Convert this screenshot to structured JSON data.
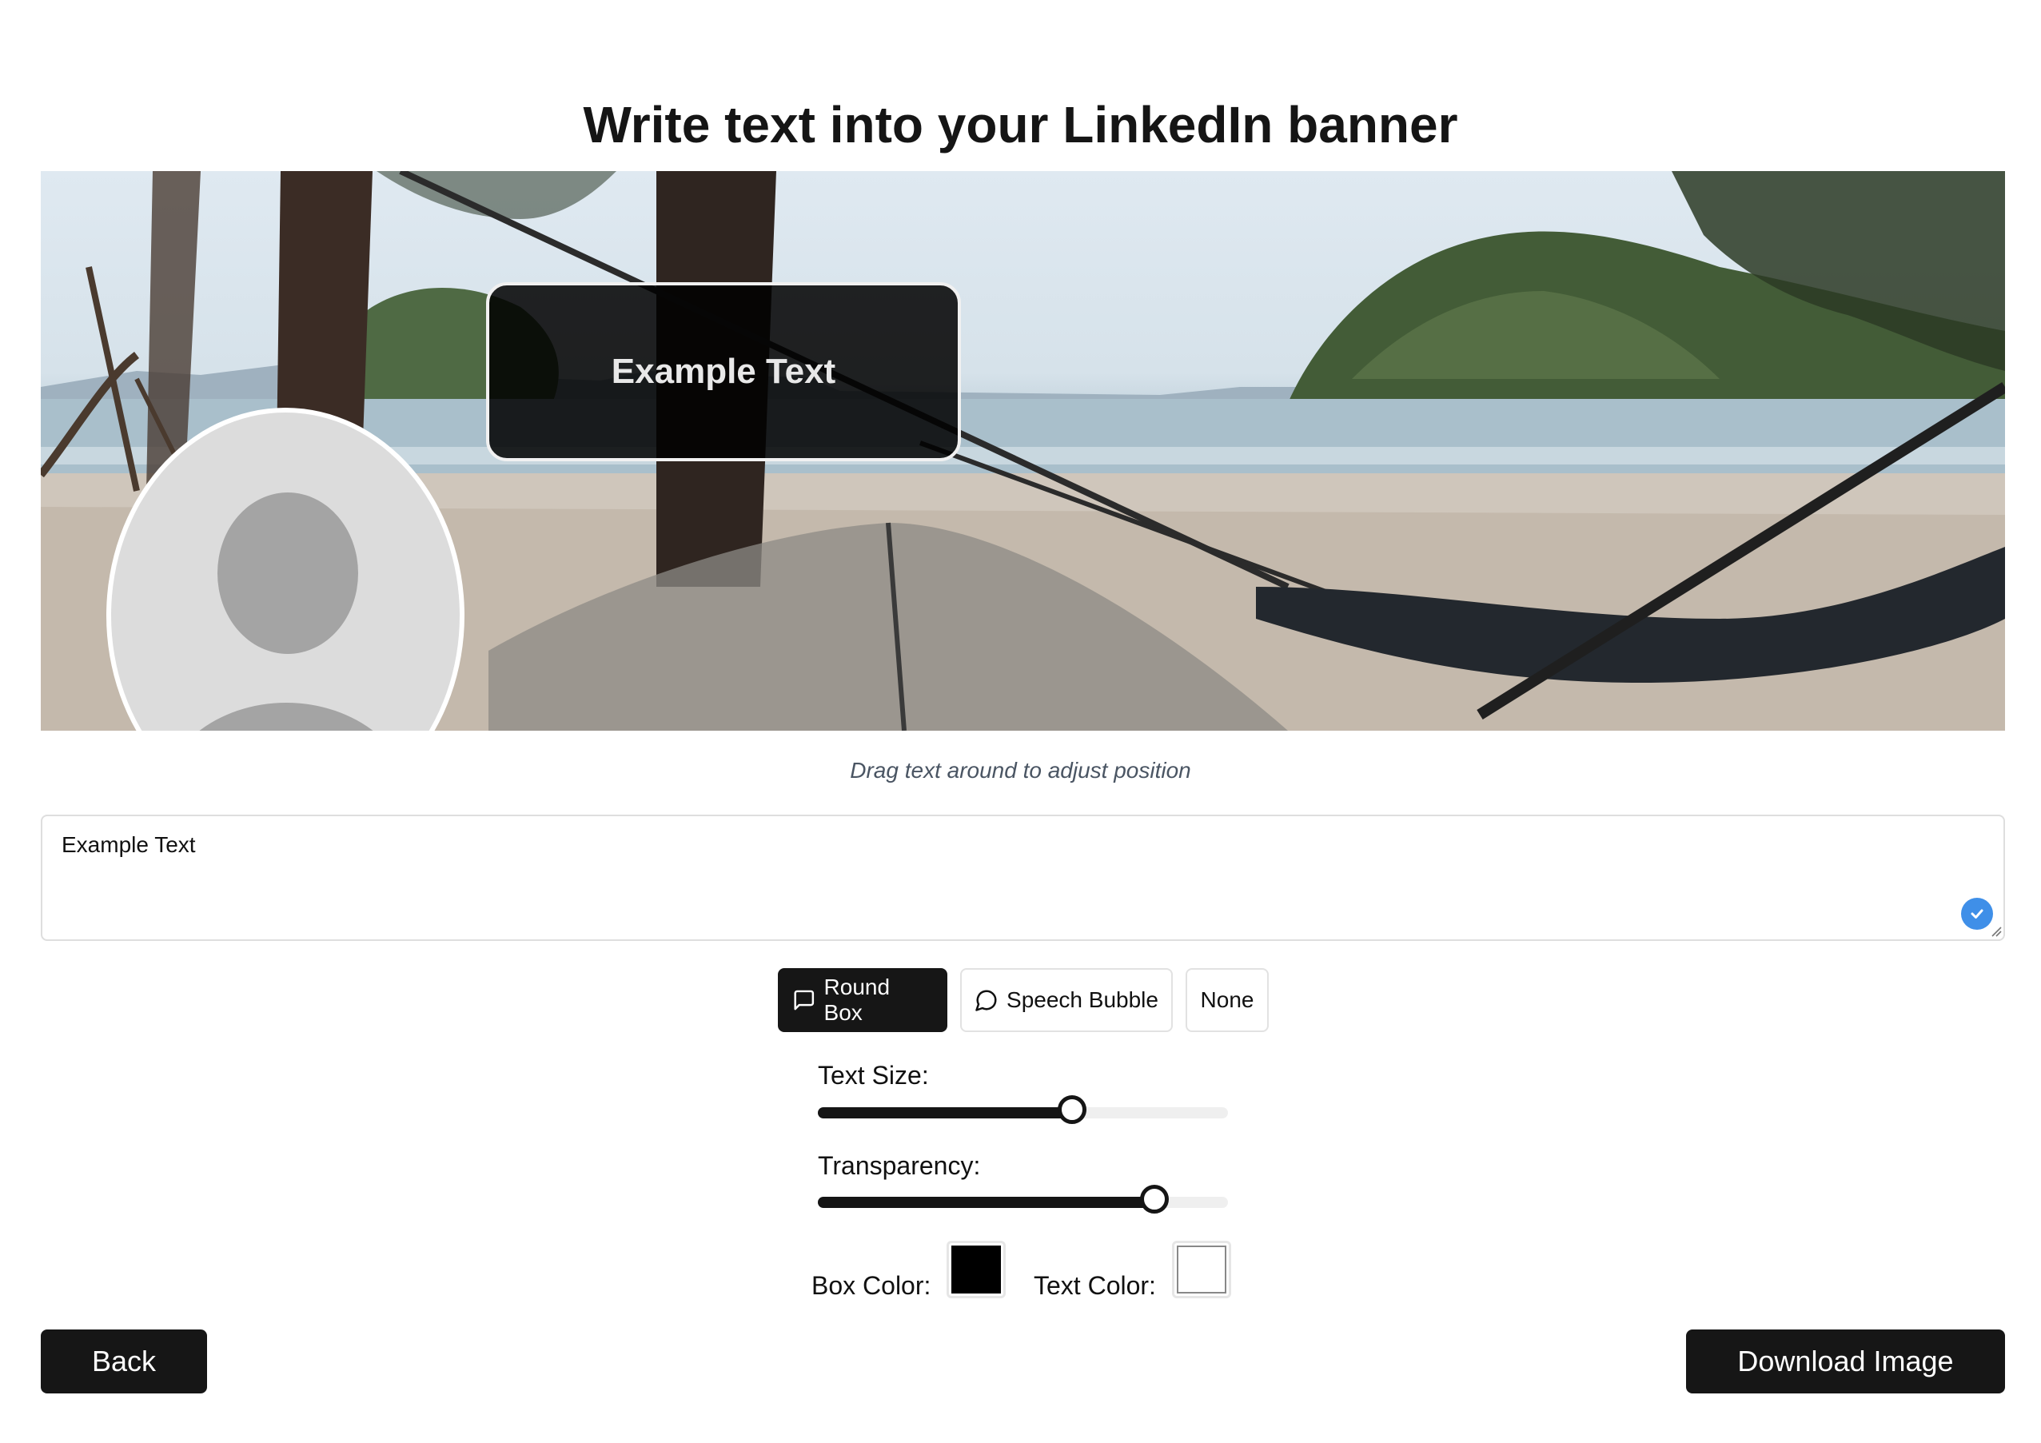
{
  "page": {
    "title": "Write text into your LinkedIn banner"
  },
  "banner": {
    "overlay_text": "Example Text",
    "hint": "Drag text around to adjust position"
  },
  "editor": {
    "text_value": "Example Text"
  },
  "style_options": [
    {
      "label": "Round Box",
      "icon": "message-square-icon",
      "active": true
    },
    {
      "label": "Speech Bubble",
      "icon": "message-circle-icon",
      "active": false
    },
    {
      "label": "None",
      "icon": "",
      "active": false
    }
  ],
  "controls": {
    "text_size_label": "Text Size:",
    "text_size_level": 0.62,
    "transparency_label": "Transparency:",
    "transparency_level": 0.82,
    "box_color_label": "Box Color:",
    "box_color": "#000000",
    "text_color_label": "Text Color:",
    "text_color": "#ffffff"
  },
  "actions": {
    "back_label": "Back",
    "download_label": "Download Image"
  },
  "colors": {
    "accent_dark": "#161616",
    "check_badge": "#3f8fe8",
    "hint_text": "#4a5563"
  }
}
